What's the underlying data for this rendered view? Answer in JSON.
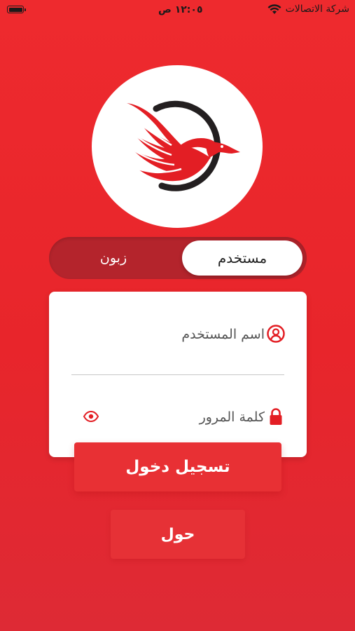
{
  "status_bar": {
    "time": "١٢:٠٥ ص",
    "carrier": "شركة الاتصالات",
    "wifi_icon": "wifi-icon",
    "battery_icon": "battery-icon"
  },
  "logo": {
    "icon": "eagle-logo-icon",
    "colors": {
      "red": "#e31e24",
      "dark": "#231f20"
    }
  },
  "toggle": {
    "selected_label": "مستخدم",
    "other_label": "زبون"
  },
  "form": {
    "username_placeholder": "اسم المستخدم",
    "password_placeholder": "كلمة المرور",
    "username_icon": "user-circle-icon",
    "password_icon": "lock-icon",
    "show_password_icon": "eye-icon"
  },
  "buttons": {
    "login_label": "تسجيل دخول",
    "about_label": "حول"
  },
  "colors": {
    "background": "#ec2a2f",
    "accent": "#e31e24",
    "toggle_track": "#b4242c"
  }
}
